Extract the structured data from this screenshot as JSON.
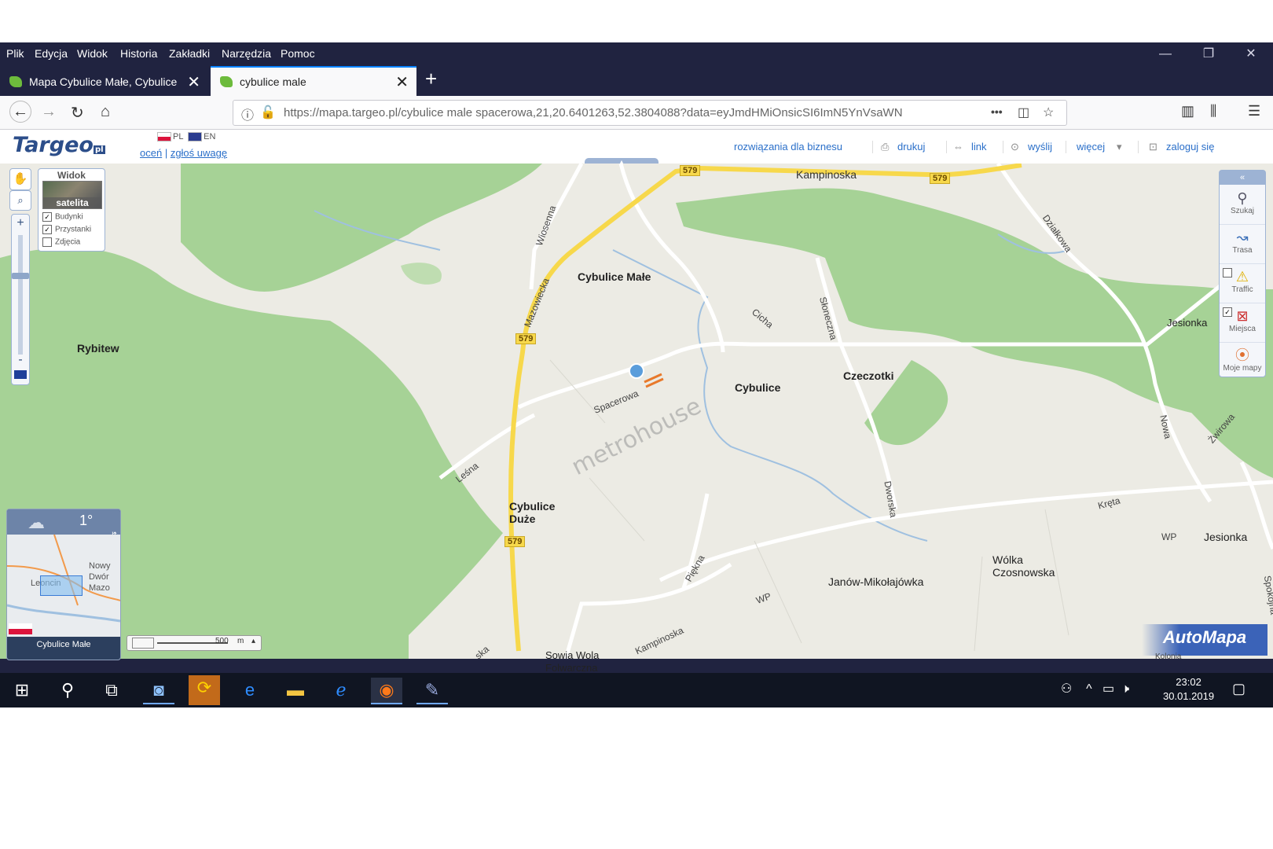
{
  "menubar": {
    "items": [
      "Plik",
      "Edycja",
      "Widok",
      "Historia",
      "Zakładki",
      "Narzędzia",
      "Pomoc"
    ],
    "window_controls": {
      "minimize": "—",
      "restore": "❐",
      "close": "✕"
    }
  },
  "tabs": [
    {
      "title": "Mapa Cybulice Małe, Cybulice",
      "close": "✕"
    },
    {
      "title": "cybulice male",
      "close": "✕"
    }
  ],
  "new_tab": "+",
  "navbar": {
    "url": "https://mapa.targeo.pl/cybulice male spacerowa,21,20.6401263,52.3804088?data=eyJmdHMiOnsicSI6ImN5YnVsaWN",
    "more": "•••"
  },
  "site": {
    "logo": "Targeo",
    "logo_suffix": "pl",
    "lang_pl": "PL",
    "lang_en": "EN",
    "rate": "oceń",
    "report": "zgłoś uwagę",
    "top_links": [
      "rozwiązania dla biznesu",
      "drukuj",
      "link",
      "wyślij",
      "więcej",
      "zaloguj się"
    ]
  },
  "map": {
    "view_panel": {
      "title": "Widok",
      "mode": "satelita",
      "layers": [
        {
          "label": "Budynki",
          "checked": true
        },
        {
          "label": "Przystanki",
          "checked": true
        },
        {
          "label": "Zdjęcia",
          "checked": false
        }
      ]
    },
    "zoom": {
      "in": "+",
      "out": "-"
    },
    "places": [
      "Cybulice Małe",
      "Rybitew",
      "Cybulice",
      "Czeczotki",
      "Cybulice Duże",
      "Jesionka",
      "Jesionka",
      "Wólka Czosnowska",
      "Janów-Mikołajówka",
      "Sowia Wola Folwarczna",
      "Kolonia"
    ],
    "streets": [
      "Kampinoska",
      "Wiosenna",
      "Mazowiecka",
      "Cicha",
      "Słoneczna",
      "Działkowa",
      "Spacerowa",
      "Leśna",
      "Nowa",
      "Żwirowa",
      "Dworska",
      "Kręta",
      "WP",
      "WP",
      "Piękna",
      "Kampinoska",
      "Spokojna",
      "ska"
    ],
    "road_number": "579",
    "watermark": "metrohouse",
    "minimap": {
      "temperature": "1°",
      "labels": [
        "Nowy",
        "Dwór",
        "Mazo",
        "Leoncin"
      ],
      "place": "Cybulice Małe"
    },
    "scale": {
      "value": "500",
      "unit": "m"
    },
    "right_panel": [
      {
        "label": "Szukaj",
        "checkbox": null
      },
      {
        "label": "Trasa",
        "checkbox": null
      },
      {
        "label": "Traffic",
        "checkbox": false
      },
      {
        "label": "Miejsca",
        "checkbox": true
      },
      {
        "label": "Moje mapy",
        "checkbox": null
      }
    ],
    "automapa": "AutoMapa"
  },
  "taskbar": {
    "time": "23:02",
    "date": "30.01.2019"
  },
  "colors": {
    "menubar": "#202340",
    "forest": "#a6d296",
    "map_bg": "#ecebe4",
    "road_579": "#f7d84b",
    "link": "#2a6fc9",
    "taskbar": "#101522"
  }
}
